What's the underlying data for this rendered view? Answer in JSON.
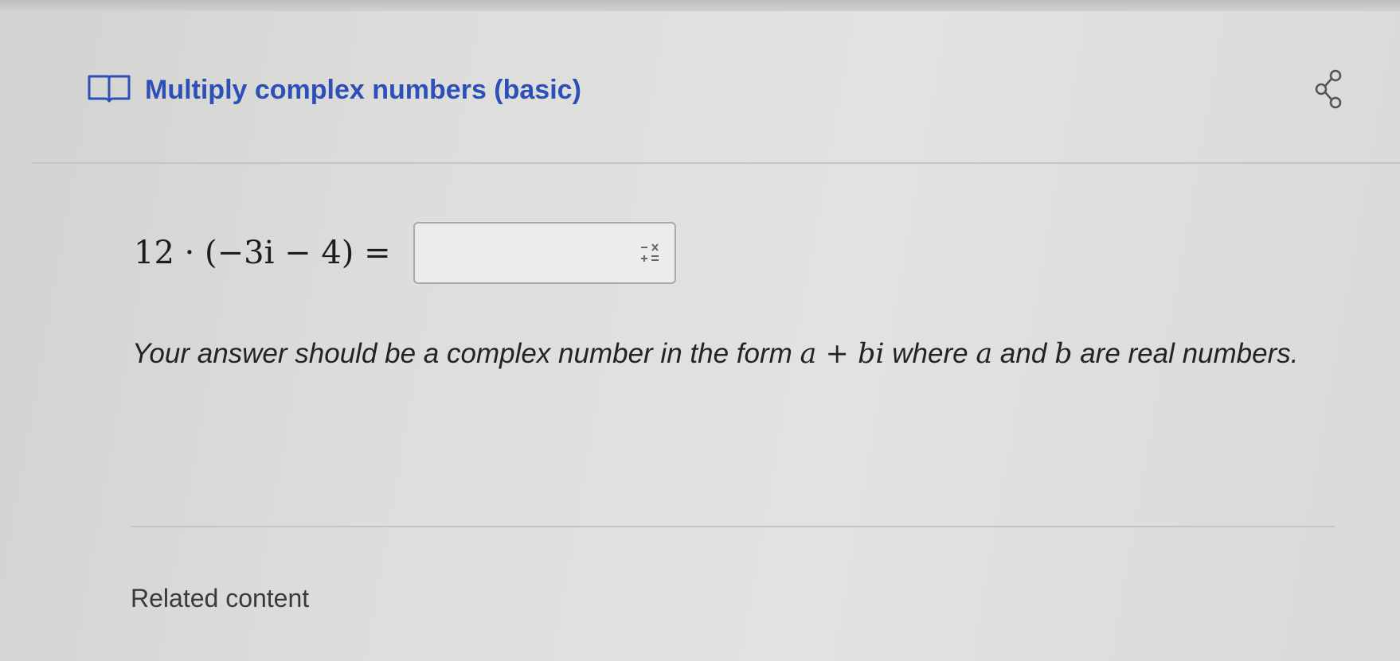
{
  "exercise": {
    "title": "Multiply complex numbers (basic)",
    "book_icon": "book-icon",
    "share_icon": "share-icon"
  },
  "problem": {
    "equation": "12 · (−3i − 4) =",
    "answer_value": "",
    "math_keypad_icon": "math-keypad-icon"
  },
  "instructions": {
    "part1": "Your answer should be a complex number in the form ",
    "expr": "a + bi",
    "part2": " where ",
    "var_a": "a",
    "part3": " and ",
    "var_b": "b",
    "part4": " are real numbers."
  },
  "related": {
    "label": "Related content"
  },
  "colors": {
    "title_blue": "#2c4fb8",
    "text": "#232323",
    "background": "#dddddb"
  }
}
